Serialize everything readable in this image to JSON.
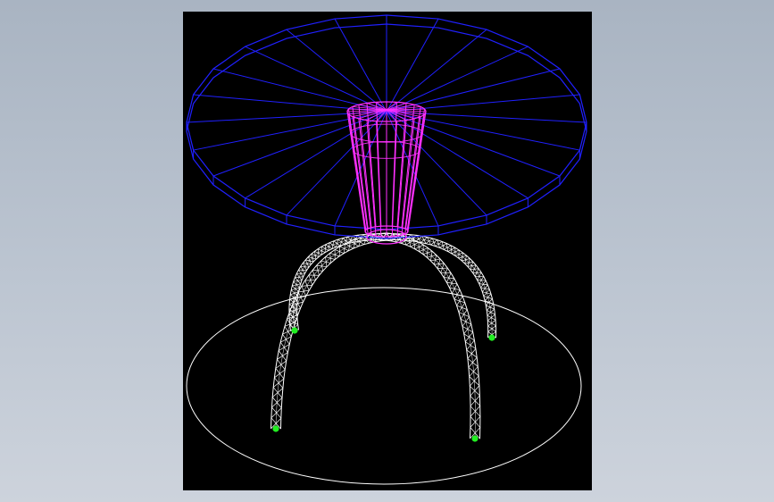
{
  "viewport": {
    "background": "#000000",
    "outside_background": "#b4becb"
  },
  "model": {
    "tabletop_color": "#2020ff",
    "pedestal_color": "#ff30ff",
    "legs_color": "#ffffff",
    "floor_ellipse_color": "#ffffff",
    "foot_marker_color": "#22ee22",
    "tabletop_segments": 24,
    "pedestal_segments": 24,
    "leg_count": 4
  }
}
